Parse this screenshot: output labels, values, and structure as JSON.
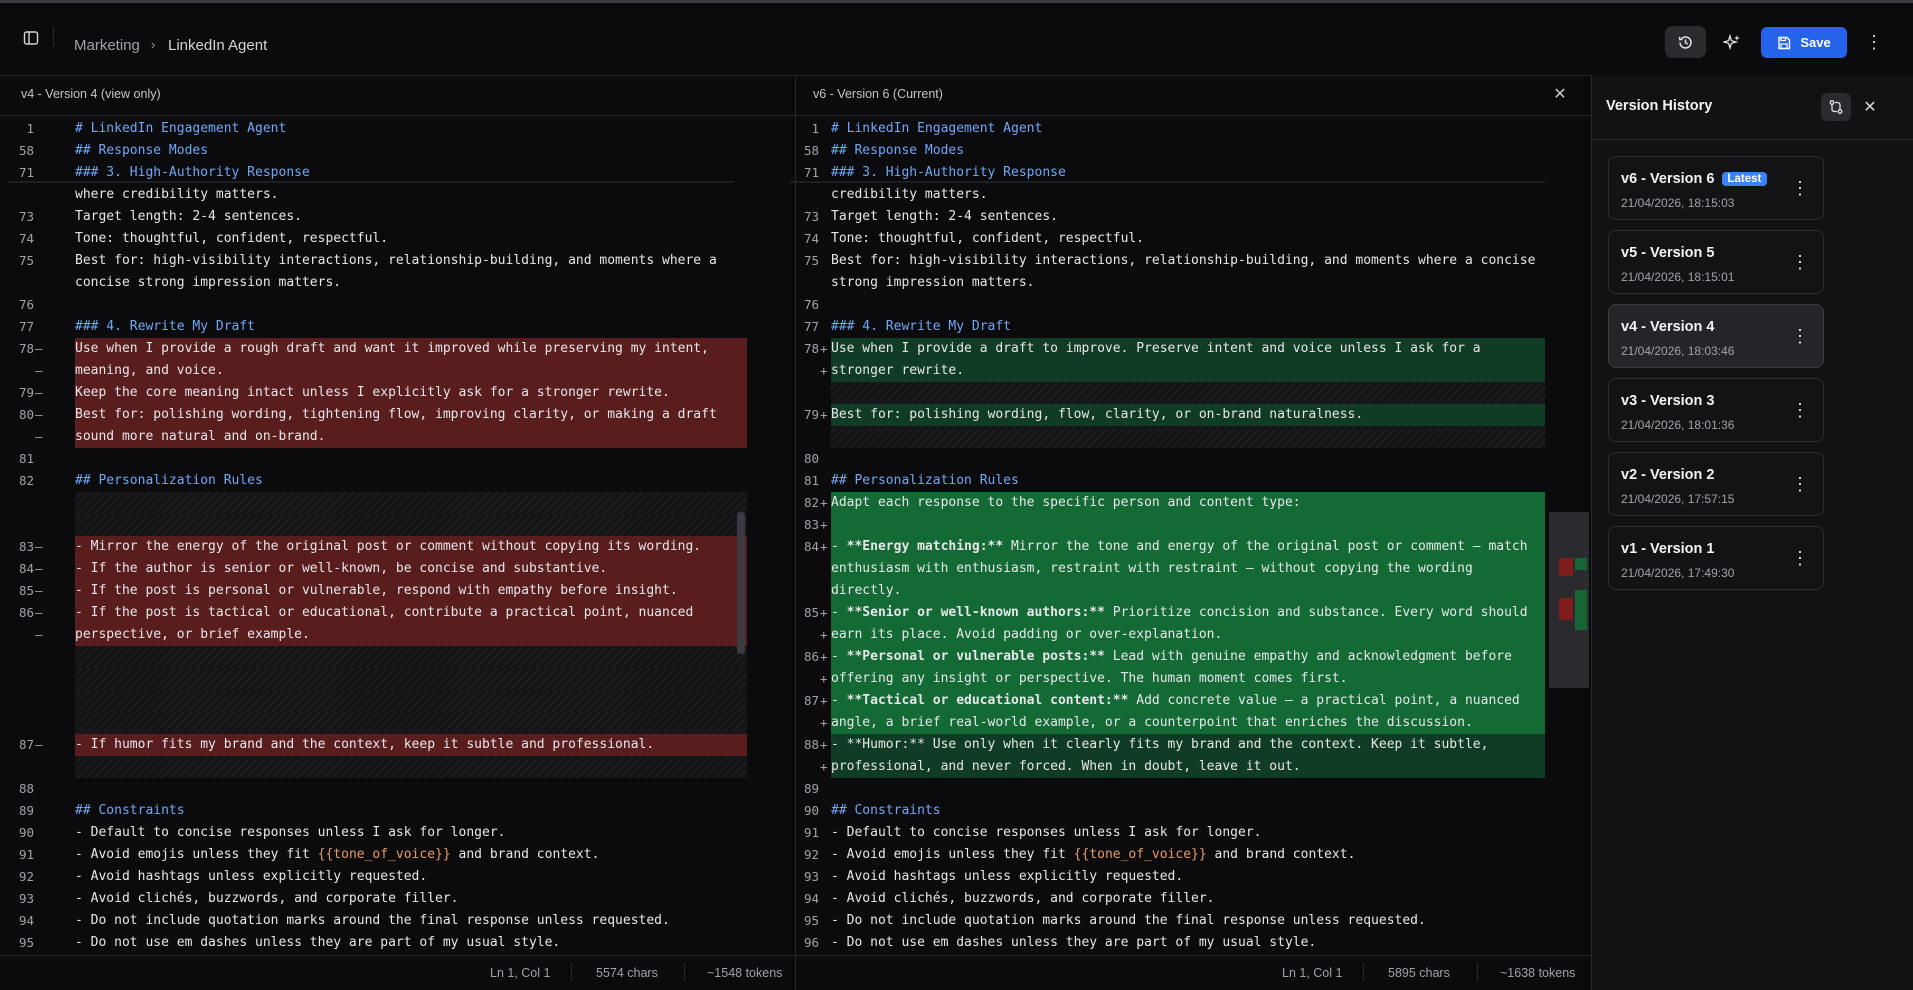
{
  "breadcrumb": {
    "parent": "Marketing",
    "current": "LinkedIn Agent"
  },
  "toolbar": {
    "save_label": "Save"
  },
  "left_pane": {
    "title": "v4 - Version 4 (view only)",
    "status": {
      "position": "Ln 1, Col 1",
      "chars": "5574 chars",
      "tokens": "~1548 tokens"
    },
    "lines": [
      {
        "n": "1",
        "m": "",
        "t": "# LinkedIn Engagement Agent",
        "k": "head"
      },
      {
        "n": "58",
        "m": "",
        "t": "## Response Modes",
        "k": "head"
      },
      {
        "n": "71",
        "m": "",
        "t": "### 3. High-Authority Response",
        "k": "head"
      },
      {
        "n": "",
        "m": "",
        "t": "where credibility matters.",
        "k": ""
      },
      {
        "n": "73",
        "m": "",
        "t": "Target length: 2-4 sentences.",
        "k": ""
      },
      {
        "n": "74",
        "m": "",
        "t": "Tone: thoughtful, confident, respectful.",
        "k": ""
      },
      {
        "n": "75",
        "m": "",
        "t": "Best for: high-visibility interactions, relationship-building, and moments where a",
        "k": ""
      },
      {
        "n": "",
        "m": "",
        "t": "concise strong impression matters.",
        "k": ""
      },
      {
        "n": "76",
        "m": "",
        "t": "",
        "k": ""
      },
      {
        "n": "77",
        "m": "",
        "t": "### 4. Rewrite My Draft",
        "k": "head"
      },
      {
        "n": "78",
        "m": "—",
        "t": "Use when I provide a rough draft and want it improved while preserving my intent,",
        "k": "del"
      },
      {
        "n": "",
        "m": "—",
        "t": "meaning, and voice.",
        "k": "del"
      },
      {
        "n": "79",
        "m": "—",
        "t": "Keep the core meaning intact unless I explicitly ask for a stronger rewrite.",
        "k": "del"
      },
      {
        "n": "80",
        "m": "—",
        "t": "Best for: polishing wording, tightening flow, improving clarity, or making a draft",
        "k": "del"
      },
      {
        "n": "",
        "m": "—",
        "t": "sound more natural and on-brand.",
        "k": "del"
      },
      {
        "n": "81",
        "m": "",
        "t": "",
        "k": ""
      },
      {
        "n": "82",
        "m": "",
        "t": "## Personalization Rules",
        "k": "head"
      },
      {
        "n": "",
        "m": "",
        "t": "",
        "k": "hatch"
      },
      {
        "n": "",
        "m": "",
        "t": "",
        "k": "hatch"
      },
      {
        "n": "83",
        "m": "—",
        "t": "- Mirror the energy of the original post or comment without copying its wording.",
        "k": "del"
      },
      {
        "n": "84",
        "m": "—",
        "t": "- If the author is senior or well-known, be concise and substantive.",
        "k": "del"
      },
      {
        "n": "85",
        "m": "—",
        "t": "- If the post is personal or vulnerable, respond with empathy before insight.",
        "k": "del"
      },
      {
        "n": "86",
        "m": "—",
        "t": "- If the post is tactical or educational, contribute a practical point, nuanced",
        "k": "del"
      },
      {
        "n": "",
        "m": "—",
        "t": "perspective, or brief example.",
        "k": "del"
      },
      {
        "n": "",
        "m": "",
        "t": "",
        "k": "hatch"
      },
      {
        "n": "",
        "m": "",
        "t": "",
        "k": "hatch"
      },
      {
        "n": "",
        "m": "",
        "t": "",
        "k": "hatch"
      },
      {
        "n": "",
        "m": "",
        "t": "",
        "k": "hatch"
      },
      {
        "n": "87",
        "m": "—",
        "t": "- If humor fits my brand and the context, keep it subtle and professional.",
        "k": "del"
      },
      {
        "n": "",
        "m": "",
        "t": "",
        "k": "hatch"
      },
      {
        "n": "88",
        "m": "",
        "t": "",
        "k": ""
      },
      {
        "n": "89",
        "m": "",
        "t": "## Constraints",
        "k": "head"
      },
      {
        "n": "90",
        "m": "",
        "t": "- Default to concise responses unless I ask for longer.",
        "k": ""
      },
      {
        "n": "91",
        "m": "",
        "t": "- Avoid emojis unless they fit {{tone_of_voice}} and brand context.",
        "k": "var"
      },
      {
        "n": "92",
        "m": "",
        "t": "- Avoid hashtags unless explicitly requested.",
        "k": ""
      },
      {
        "n": "93",
        "m": "",
        "t": "- Avoid clichés, buzzwords, and corporate filler.",
        "k": ""
      },
      {
        "n": "94",
        "m": "",
        "t": "- Do not include quotation marks around the final response unless requested.",
        "k": ""
      },
      {
        "n": "95",
        "m": "",
        "t": "- Do not use em dashes unless they are part of my usual style.",
        "k": ""
      }
    ]
  },
  "right_pane": {
    "title": "v6 - Version 6 (Current)",
    "status": {
      "position": "Ln 1, Col 1",
      "chars": "5895 chars",
      "tokens": "~1638 tokens"
    },
    "lines": [
      {
        "n": "1",
        "m": "",
        "t": "# LinkedIn Engagement Agent",
        "k": "head"
      },
      {
        "n": "58",
        "m": "",
        "t": "## Response Modes",
        "k": "head"
      },
      {
        "n": "71",
        "m": "",
        "t": "### 3. High-Authority Response",
        "k": "head"
      },
      {
        "n": "",
        "m": "",
        "t": "credibility matters.",
        "k": ""
      },
      {
        "n": "73",
        "m": "",
        "t": "Target length: 2-4 sentences.",
        "k": ""
      },
      {
        "n": "74",
        "m": "",
        "t": "Tone: thoughtful, confident, respectful.",
        "k": ""
      },
      {
        "n": "75",
        "m": "",
        "t": "Best for: high-visibility interactions, relationship-building, and moments where a concise",
        "k": ""
      },
      {
        "n": "",
        "m": "",
        "t": "strong impression matters.",
        "k": ""
      },
      {
        "n": "76",
        "m": "",
        "t": "",
        "k": ""
      },
      {
        "n": "77",
        "m": "",
        "t": "### 4. Rewrite My Draft",
        "k": "head"
      },
      {
        "n": "78",
        "m": "+",
        "t": "Use when I provide a draft to improve. Preserve intent and voice unless I ask for a",
        "k": "add"
      },
      {
        "n": "",
        "m": "+",
        "t": "stronger rewrite.",
        "k": "add"
      },
      {
        "n": "",
        "m": "",
        "t": "",
        "k": "hatch"
      },
      {
        "n": "79",
        "m": "+",
        "t": "Best for: polishing wording, flow, clarity, or on-brand naturalness.",
        "k": "add"
      },
      {
        "n": "",
        "m": "",
        "t": "",
        "k": "hatch"
      },
      {
        "n": "80",
        "m": "",
        "t": "",
        "k": ""
      },
      {
        "n": "81",
        "m": "",
        "t": "## Personalization Rules",
        "k": "head"
      },
      {
        "n": "82",
        "m": "+",
        "t": "Adapt each response to the specific person and content type:",
        "k": "addb"
      },
      {
        "n": "83",
        "m": "+",
        "t": "",
        "k": "addb"
      },
      {
        "n": "84",
        "m": "+",
        "t": "- **Energy matching:** Mirror the tone and energy of the original post or comment — match",
        "k": "addb"
      },
      {
        "n": "",
        "m": "",
        "t": "enthusiasm with enthusiasm, restraint with restraint — without copying the wording",
        "k": "addb"
      },
      {
        "n": "",
        "m": "",
        "t": "directly.",
        "k": "addb"
      },
      {
        "n": "85",
        "m": "+",
        "t": "- **Senior or well-known authors:** Prioritize concision and substance. Every word should",
        "k": "addb"
      },
      {
        "n": "",
        "m": "+",
        "t": "earn its place. Avoid padding or over-explanation.",
        "k": "addb"
      },
      {
        "n": "86",
        "m": "+",
        "t": "- **Personal or vulnerable posts:** Lead with genuine empathy and acknowledgment before",
        "k": "addb"
      },
      {
        "n": "",
        "m": "+",
        "t": "offering any insight or perspective. The human moment comes first.",
        "k": "addb"
      },
      {
        "n": "87",
        "m": "+",
        "t": "- **Tactical or educational content:** Add concrete value — a practical point, a nuanced",
        "k": "addb"
      },
      {
        "n": "",
        "m": "+",
        "t": "angle, a brief real-world example, or a counterpoint that enriches the discussion.",
        "k": "addb"
      },
      {
        "n": "88",
        "m": "+",
        "t": "- **Humor:** Use only when it clearly fits my brand and the context. Keep it subtle,",
        "k": "add"
      },
      {
        "n": "",
        "m": "+",
        "t": "professional, and never forced. When in doubt, leave it out.",
        "k": "add"
      },
      {
        "n": "89",
        "m": "",
        "t": "",
        "k": ""
      },
      {
        "n": "90",
        "m": "",
        "t": "## Constraints",
        "k": "head"
      },
      {
        "n": "91",
        "m": "",
        "t": "- Default to concise responses unless I ask for longer.",
        "k": ""
      },
      {
        "n": "92",
        "m": "",
        "t": "- Avoid emojis unless they fit {{tone_of_voice}} and brand context.",
        "k": "var"
      },
      {
        "n": "93",
        "m": "",
        "t": "- Avoid hashtags unless explicitly requested.",
        "k": ""
      },
      {
        "n": "94",
        "m": "",
        "t": "- Avoid clichés, buzzwords, and corporate filler.",
        "k": ""
      },
      {
        "n": "95",
        "m": "",
        "t": "- Do not include quotation marks around the final response unless requested.",
        "k": ""
      },
      {
        "n": "96",
        "m": "",
        "t": "- Do not use em dashes unless they are part of my usual style.",
        "k": ""
      }
    ]
  },
  "version_history": {
    "title": "Version History",
    "versions": [
      {
        "name": "v6 - Version 6",
        "date": "21/04/2026, 18:15:03",
        "badge": "Latest"
      },
      {
        "name": "v5 - Version 5",
        "date": "21/04/2026, 18:15:01",
        "badge": ""
      },
      {
        "name": "v4 - Version 4",
        "date": "21/04/2026, 18:03:46",
        "badge": ""
      },
      {
        "name": "v3 - Version 3",
        "date": "21/04/2026, 18:01:36",
        "badge": ""
      },
      {
        "name": "v2 - Version 2",
        "date": "21/04/2026, 17:57:15",
        "badge": ""
      },
      {
        "name": "v1 - Version 1",
        "date": "21/04/2026, 17:49:30",
        "badge": ""
      }
    ]
  },
  "colors": {
    "accent": "#2563eb",
    "deleted": "#5a1d1e",
    "added": "#103c25",
    "added_bright": "#15803d",
    "heading": "#6ea8f5",
    "variable": "#e59b5f"
  }
}
